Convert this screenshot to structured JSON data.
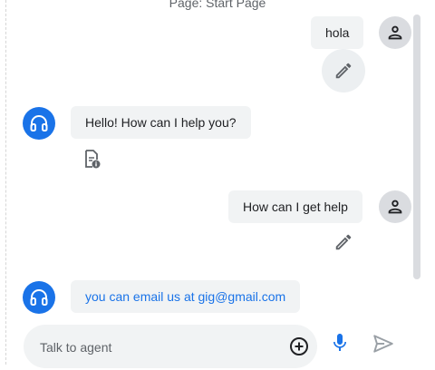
{
  "header": {
    "page_label": "Page: Start Page"
  },
  "messages": [
    {
      "role": "user",
      "text": "hola"
    },
    {
      "role": "agent",
      "text": "Hello! How can I help you?"
    },
    {
      "role": "user",
      "text": "How can I get help"
    },
    {
      "role": "agent",
      "text": "you can email us at gig@gmail.com"
    }
  ],
  "composer": {
    "placeholder": "Talk to agent",
    "value": ""
  },
  "colors": {
    "accent": "#1a73e8",
    "bubble": "#f1f3f4",
    "user_avatar": "#dadce0"
  },
  "icons": {
    "user_avatar": "person-icon",
    "agent_avatar": "headset-icon",
    "edit": "pencil-icon",
    "info_doc": "document-info-icon",
    "add": "add-circle-icon",
    "mic": "mic-icon",
    "send": "send-icon"
  }
}
